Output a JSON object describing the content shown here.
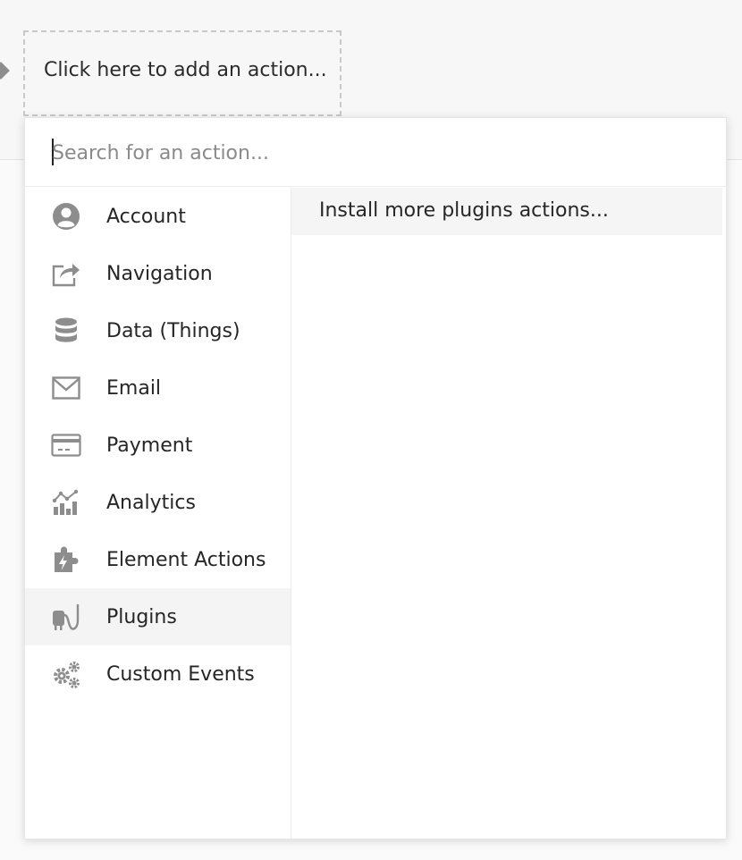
{
  "workflow": {
    "add_action_label": "Click here to add an action..."
  },
  "search": {
    "placeholder": "Search for an action...",
    "value": ""
  },
  "categories": [
    {
      "label": "Account",
      "icon": "user-circle-icon"
    },
    {
      "label": "Navigation",
      "icon": "share-arrow-icon"
    },
    {
      "label": "Data (Things)",
      "icon": "database-icon"
    },
    {
      "label": "Email",
      "icon": "envelope-icon"
    },
    {
      "label": "Payment",
      "icon": "credit-card-icon"
    },
    {
      "label": "Analytics",
      "icon": "chart-icon"
    },
    {
      "label": "Element Actions",
      "icon": "puzzle-bolt-icon"
    },
    {
      "label": "Plugins",
      "icon": "plug-icon",
      "active": true
    },
    {
      "label": "Custom Events",
      "icon": "gears-icon"
    }
  ],
  "actions": {
    "items": [
      "Install more plugins actions..."
    ]
  },
  "colors": {
    "icon": "#8d8d8d",
    "active_bg": "#f4f4f5",
    "text": "#262626"
  }
}
